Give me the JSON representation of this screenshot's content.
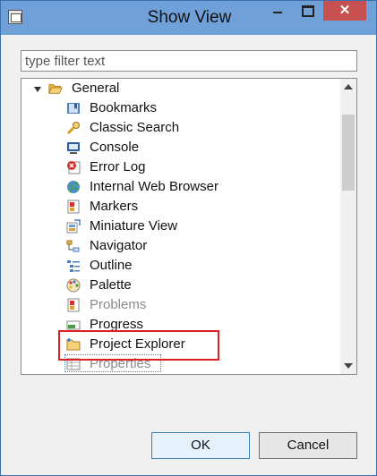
{
  "window": {
    "title": "Show View",
    "close_glyph": "✕"
  },
  "filter": {
    "placeholder": "type filter text",
    "value": ""
  },
  "tree": {
    "category": {
      "label": "General",
      "expanded": true,
      "icon": "folder-open-icon"
    },
    "items": [
      {
        "label": "Bookmarks",
        "icon": "bookmarks-icon",
        "state": "normal"
      },
      {
        "label": "Classic Search",
        "icon": "search-icon",
        "state": "normal"
      },
      {
        "label": "Console",
        "icon": "console-icon",
        "state": "normal"
      },
      {
        "label": "Error Log",
        "icon": "error-log-icon",
        "state": "normal"
      },
      {
        "label": "Internal Web Browser",
        "icon": "globe-icon",
        "state": "normal"
      },
      {
        "label": "Markers",
        "icon": "markers-icon",
        "state": "normal"
      },
      {
        "label": "Miniature View",
        "icon": "miniature-view-icon",
        "state": "normal"
      },
      {
        "label": "Navigator",
        "icon": "navigator-icon",
        "state": "normal"
      },
      {
        "label": "Outline",
        "icon": "outline-icon",
        "state": "normal"
      },
      {
        "label": "Palette",
        "icon": "palette-icon",
        "state": "normal"
      },
      {
        "label": "Problems",
        "icon": "problems-icon",
        "state": "dimmed"
      },
      {
        "label": "Progress",
        "icon": "progress-icon",
        "state": "normal"
      },
      {
        "label": "Project Explorer",
        "icon": "project-explorer-icon",
        "state": "highlighted"
      },
      {
        "label": "Properties",
        "icon": "properties-icon",
        "state": "dimmed"
      }
    ]
  },
  "buttons": {
    "ok": "OK",
    "cancel": "Cancel"
  },
  "colors": {
    "titlebar": "#6fa0d8",
    "close": "#c75050",
    "highlight": "#e02020",
    "dimmed_text": "#8a8a8a"
  }
}
